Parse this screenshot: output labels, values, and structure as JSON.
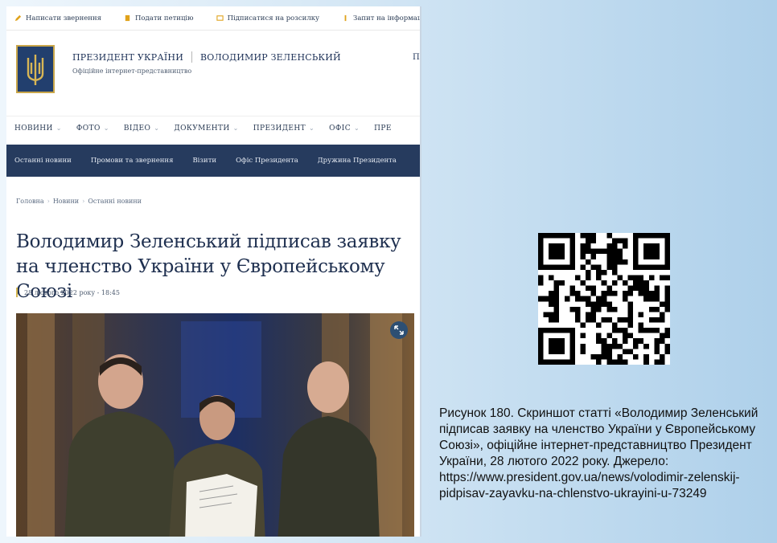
{
  "topbar": {
    "items": [
      {
        "label": "Написати звернення",
        "icon": "pencil-icon"
      },
      {
        "label": "Подати петицію",
        "icon": "document-icon"
      },
      {
        "label": "Підписатися на розсилку",
        "icon": "envelope-icon"
      },
      {
        "label": "Запит на інформацію",
        "icon": "info-icon"
      }
    ]
  },
  "brand": {
    "title": "ПРЕЗИДЕНТ УКРАЇНИ",
    "name": "ВОЛОДИМИР ЗЕЛЕНСЬКИЙ",
    "subtitle": "Офіційне інтернет-представництво",
    "cut_text": "Пр",
    "emblem": "trident-emblem-icon"
  },
  "main_nav": [
    "НОВИНИ",
    "ФОТО",
    "ВІДЕО",
    "ДОКУМЕНТИ",
    "ПРЕЗИДЕНТ",
    "ОФІС",
    "ПРЕ"
  ],
  "sub_nav": [
    "Останні новини",
    "Промови та звернення",
    "Візити",
    "Офіс Президента",
    "Дружина Президента"
  ],
  "breadcrumb": [
    "Головна",
    "Новини",
    "Останні новини"
  ],
  "article": {
    "headline": "Володимир Зеленський підписав заявку на членство України у Європейському Союзі",
    "date": "28 лютого 2022 року - 18:45"
  },
  "caption": "Рисунок 180. Скриншот статті «Володимир Зеленський підписав заявку на членство України у Європейському Союзі», офіційне інтернет-представництво Президент України, 28 лютого 2022 року. Джерело: https://www.president.gov.ua/news/volodimir-zelenskij-pidpisav-zayavku-na-chlenstvo-ukrayini-u-73249",
  "colors": {
    "nav_dark": "#263b5e",
    "headline": "#1e2f4f",
    "accent_gold": "#d3b44f"
  }
}
